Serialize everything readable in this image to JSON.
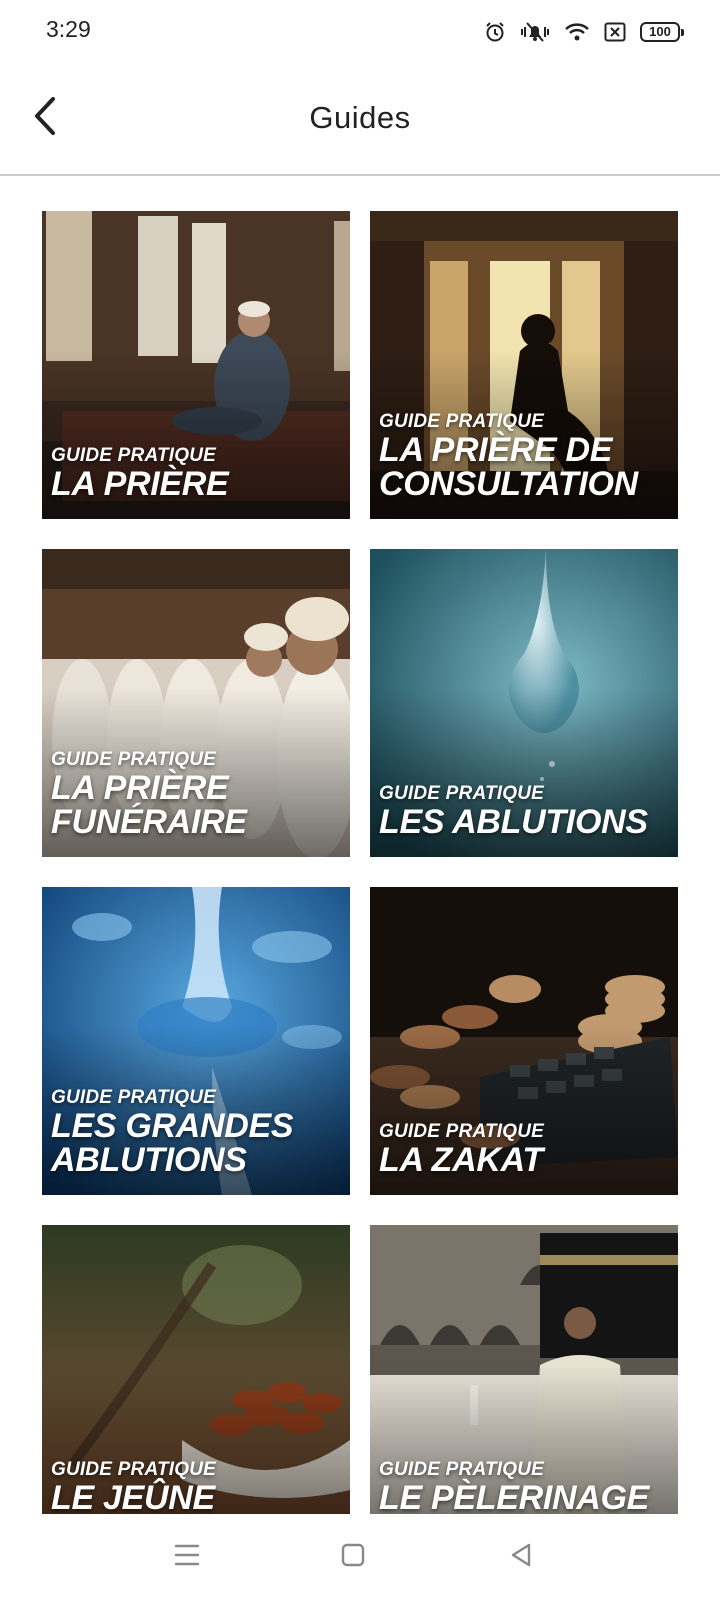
{
  "status_bar": {
    "time": "3:29",
    "battery": "100",
    "icons": [
      "alarm-icon",
      "mute-icon",
      "wifi-icon",
      "sim-off-icon",
      "battery-icon"
    ]
  },
  "header": {
    "title": "Guides",
    "back_icon": "chevron-left-icon"
  },
  "guides": [
    {
      "kicker": "GUIDE PRATIQUE",
      "title": "LA PRIÈRE"
    },
    {
      "kicker": "GUIDE PRATIQUE",
      "title": "LA PRIÈRE DE\nCONSULTATION"
    },
    {
      "kicker": "GUIDE PRATIQUE",
      "title": "LA PRIÈRE\nFUNÉRAIRE"
    },
    {
      "kicker": "GUIDE PRATIQUE",
      "title": "LES ABLUTIONS"
    },
    {
      "kicker": "GUIDE PRATIQUE",
      "title": "LES GRANDES\nABLUTIONS"
    },
    {
      "kicker": "GUIDE PRATIQUE",
      "title": "LA ZAKAT"
    },
    {
      "kicker": "GUIDE PRATIQUE",
      "title": "LE JEÛNE"
    },
    {
      "kicker": "GUIDE PRATIQUE",
      "title": "LE PÈLERINAGE"
    }
  ],
  "nav_bar": {
    "icons": [
      "menu-icon",
      "home-square-icon",
      "back-triangle-icon"
    ]
  }
}
